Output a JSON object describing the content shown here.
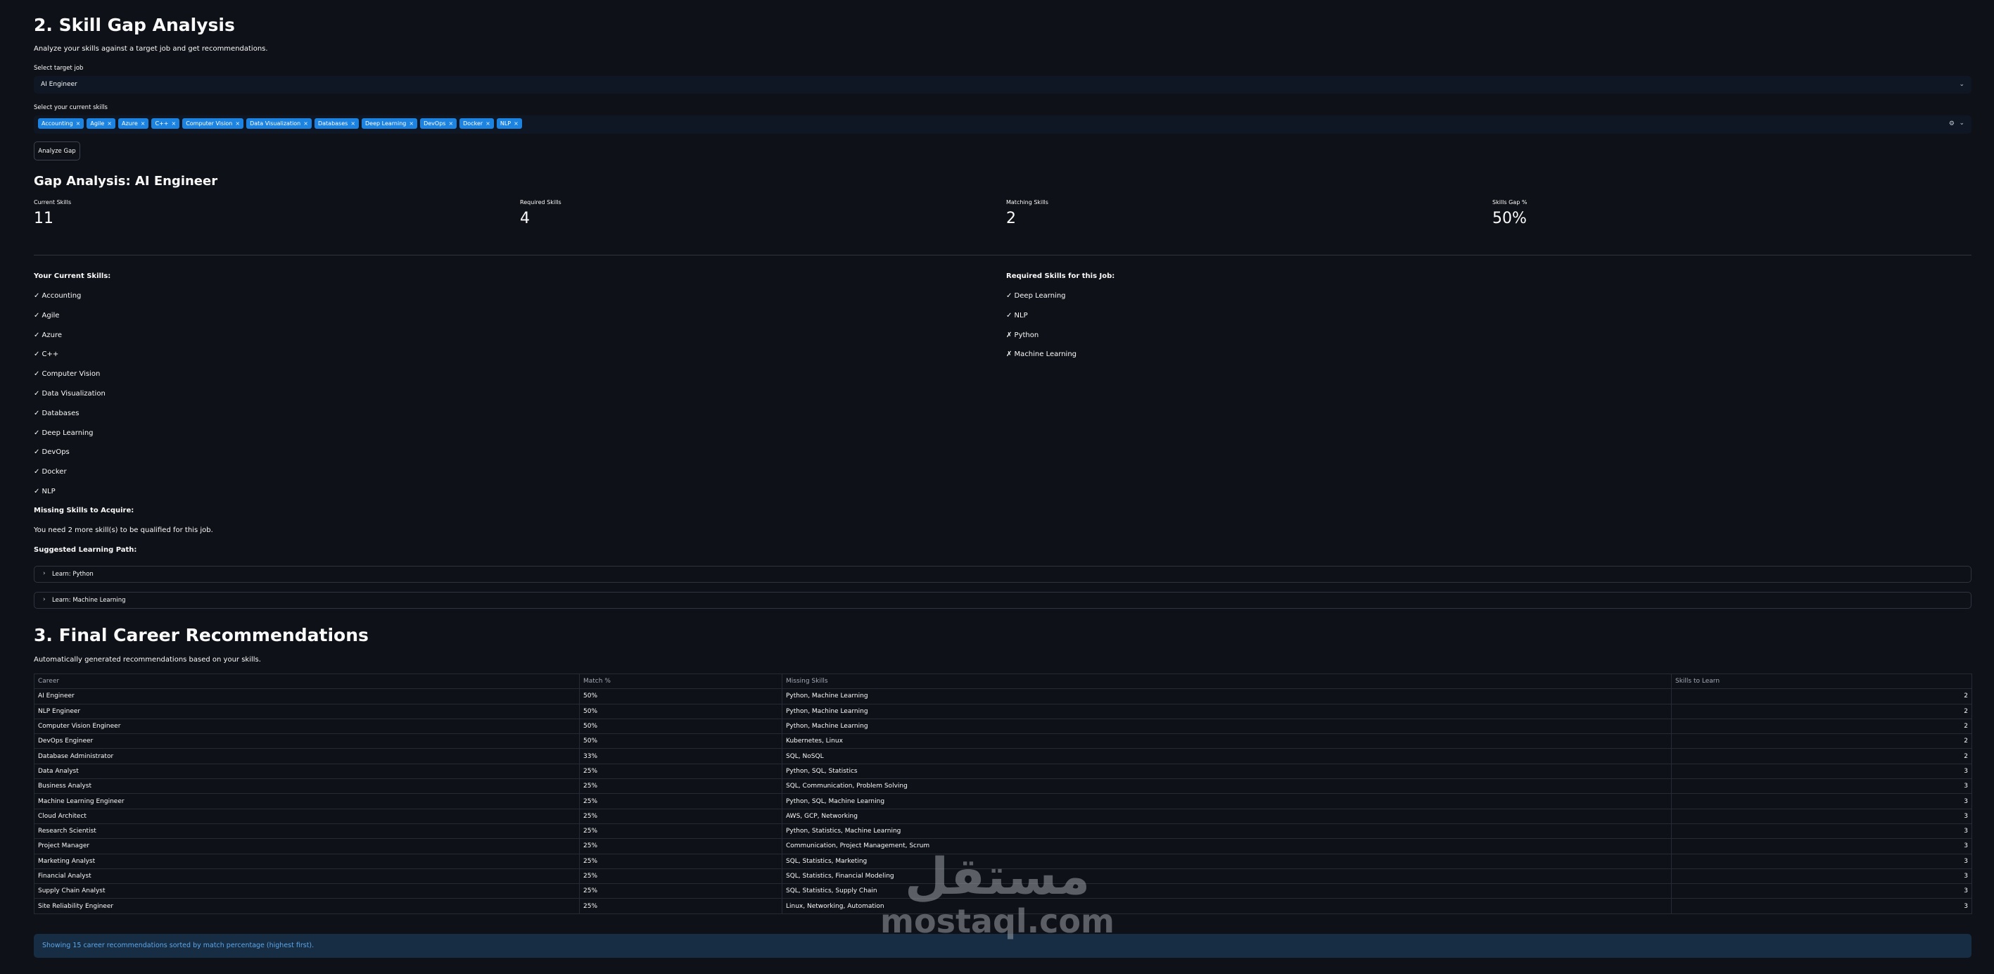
{
  "section2": {
    "title": "2. Skill Gap Analysis",
    "description": "Analyze your skills against a target job and get recommendations.",
    "target_label": "Select target job",
    "target_value": "AI Engineer",
    "skills_label": "Select your current skills",
    "selected_skills": [
      "Accounting",
      "Agile",
      "Azure",
      "C++",
      "Computer Vision",
      "Data Visualization",
      "Databases",
      "Deep Learning",
      "DevOps",
      "Docker",
      "NLP"
    ],
    "tag_remove_glyph": "×",
    "analyze_button": "Analyze Gap"
  },
  "gap": {
    "title": "Gap Analysis: AI Engineer",
    "metrics": [
      {
        "label": "Current Skills",
        "value": "11"
      },
      {
        "label": "Required Skills",
        "value": "4"
      },
      {
        "label": "Matching Skills",
        "value": "2"
      },
      {
        "label": "Skills Gap %",
        "value": "50%"
      }
    ],
    "current_title": "Your Current Skills:",
    "current_items": [
      "✓ Accounting",
      "✓ Agile",
      "✓ Azure",
      "✓ C++",
      "✓ Computer Vision",
      "✓ Data Visualization",
      "✓ Databases",
      "✓ Deep Learning",
      "✓ DevOps",
      "✓ Docker",
      "✓ NLP"
    ],
    "required_title": "Required Skills for this Job:",
    "required_items": [
      "✓ Deep Learning",
      "✓ NLP",
      "✗ Python",
      "✗ Machine Learning"
    ],
    "missing_title": "Missing Skills to Acquire:",
    "missing_text": "You need 2 more skill(s) to be qualified for this job.",
    "path_title": "Suggested Learning Path:",
    "expanders": [
      "Learn: Python",
      "Learn: Machine Learning"
    ]
  },
  "section3": {
    "title": "3. Final Career Recommendations",
    "description": "Automatically generated recommendations based on your skills.",
    "columns": [
      "Career",
      "Match %",
      "Missing Skills",
      "Skills to Learn"
    ],
    "rows": [
      [
        "AI Engineer",
        "50%",
        "Python, Machine Learning",
        "2"
      ],
      [
        "NLP Engineer",
        "50%",
        "Python, Machine Learning",
        "2"
      ],
      [
        "Computer Vision Engineer",
        "50%",
        "Python, Machine Learning",
        "2"
      ],
      [
        "DevOps Engineer",
        "50%",
        "Kubernetes, Linux",
        "2"
      ],
      [
        "Database Administrator",
        "33%",
        "SQL, NoSQL",
        "2"
      ],
      [
        "Data Analyst",
        "25%",
        "Python, SQL, Statistics",
        "3"
      ],
      [
        "Business Analyst",
        "25%",
        "SQL, Communication, Problem Solving",
        "3"
      ],
      [
        "Machine Learning Engineer",
        "25%",
        "Python, SQL, Machine Learning",
        "3"
      ],
      [
        "Cloud Architect",
        "25%",
        "AWS, GCP, Networking",
        "3"
      ],
      [
        "Research Scientist",
        "25%",
        "Python, Statistics, Machine Learning",
        "3"
      ],
      [
        "Project Manager",
        "25%",
        "Communication, Project Management, Scrum",
        "3"
      ],
      [
        "Marketing Analyst",
        "25%",
        "SQL, Statistics, Marketing",
        "3"
      ],
      [
        "Financial Analyst",
        "25%",
        "SQL, Statistics, Financial Modeling",
        "3"
      ],
      [
        "Supply Chain Analyst",
        "25%",
        "SQL, Statistics, Supply Chain",
        "3"
      ],
      [
        "Site Reliability Engineer",
        "25%",
        "Linux, Networking, Automation",
        "3"
      ]
    ],
    "info": "Showing 15 career recommendations sorted by match percentage (highest first)."
  },
  "watermark": {
    "arabic": "مستقل",
    "latin": "mostaql.com"
  },
  "icons": {
    "chevron_down": "chevron-down-icon",
    "gear": "gear-icon",
    "chevron_right": "chevron-right-icon"
  },
  "colors": {
    "background": "#0e1117",
    "tag": "#1c83e1",
    "info_bg": "#172d43",
    "info_text": "#5ea6e8"
  }
}
